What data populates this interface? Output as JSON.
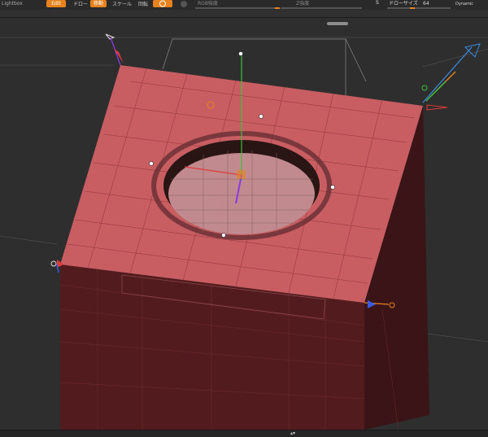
{
  "toolbar": {
    "left_text": "Lightbox",
    "edit_label": "Edit",
    "draw_label": "ドロー",
    "move_label": "移動",
    "scale_label": "スケール",
    "rotate_label": "回転",
    "rgb_label": "RGB強度",
    "z_label": "Z強度",
    "s_label": "S",
    "draw_size_label": "ドローサイズ",
    "draw_size_value": "64",
    "dynamic_label": "Dynamic"
  },
  "bottombar": {
    "arrows": "▴▾"
  },
  "colors": {
    "mesh_fill": "#c85d62",
    "mesh_dark": "#4a1c1e",
    "gizmo_orange": "#e8821c",
    "axis_green": "#38c238",
    "axis_red": "#e03a3a",
    "axis_blue": "#3a5ae0"
  },
  "icons": [
    "brush-icon",
    "sphere-icon",
    "gizmo-cone-icon"
  ]
}
